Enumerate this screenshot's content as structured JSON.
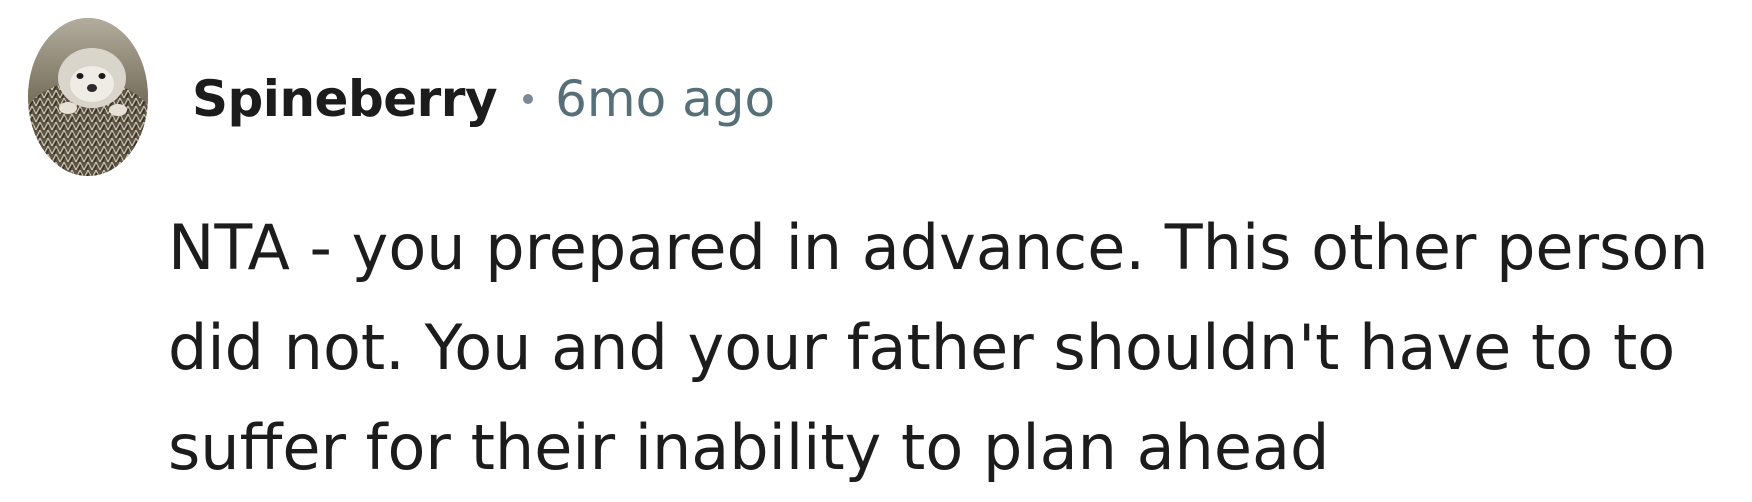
{
  "comment": {
    "author": "Spineberry",
    "timestamp": "6mo ago",
    "avatar_icon": "hedgehog-avatar-icon",
    "text_lines": [
      "NTA - you prepared in advance. This other person",
      "did not. You and your father shouldn't have to to",
      "suffer for their inability to plan ahead"
    ]
  },
  "colors": {
    "author": "#1c1c1c",
    "timestamp": "#576f76",
    "separator": "#7c8a96",
    "body": "#1c1c1c",
    "background": "#ffffff"
  }
}
